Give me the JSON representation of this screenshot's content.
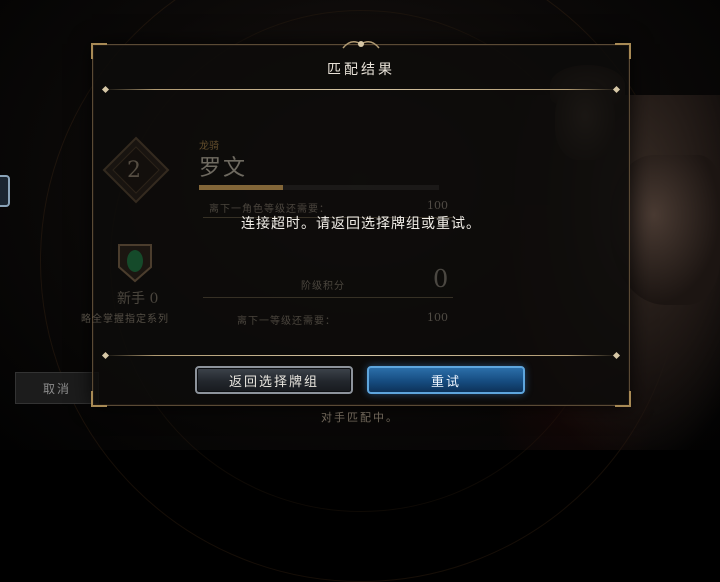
{
  "dialog": {
    "title": "匹配结果",
    "message": "连接超时。请返回选择牌组或重试。",
    "back_button": "返回选择牌组",
    "retry_button": "重试"
  },
  "background": {
    "cancel_label": "取消",
    "footer_status": "对手匹配中。",
    "badge_level": "2",
    "hero_class": "龙骑",
    "hero_name": "罗文",
    "hero_xp_progress": 0.35,
    "row1_label": "离下一角色等级还需要：",
    "row1_value": "100",
    "ladder_label": "阶级积分",
    "ladder_value": "0",
    "rank_name": "新手 0",
    "rank_desc": "略全掌握指定系列",
    "row2_label": "离下一等级还需要：",
    "row2_value": "100"
  },
  "colors": {
    "accent_gold": "#b09a72",
    "retry_blue": "#2b6ea9"
  }
}
